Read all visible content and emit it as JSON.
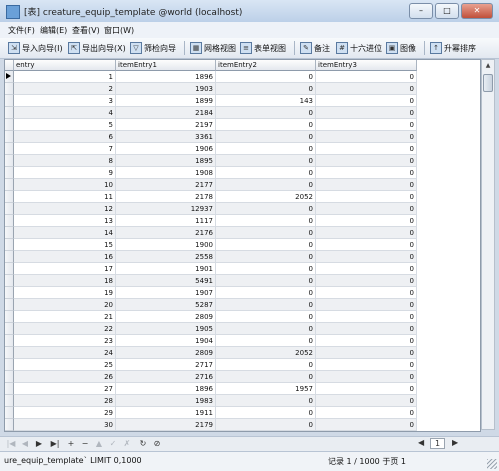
{
  "window": {
    "title": "[表] creature_equip_template @world (localhost)",
    "minimize_label": "–",
    "maximize_label": "□",
    "close_label": "✕"
  },
  "menu": [
    "文件(F)",
    "编辑(E)",
    "查看(V)",
    "窗口(W)"
  ],
  "toolbar": [
    {
      "label": "导入向导(I)",
      "icon": "import-icon"
    },
    {
      "label": "导出向导(X)",
      "icon": "export-icon"
    },
    {
      "label": "筛检向导",
      "icon": "filter-icon"
    },
    {
      "label": "网格视图",
      "icon": "grid-view-icon"
    },
    {
      "label": "表单视图",
      "icon": "form-view-icon"
    },
    {
      "label": "备注",
      "icon": "memo-icon"
    },
    {
      "label": "十六进位",
      "icon": "hex-icon"
    },
    {
      "label": "图像",
      "icon": "image-icon"
    },
    {
      "label": "升幂排序",
      "icon": "sort-asc-icon"
    }
  ],
  "table": {
    "columns": [
      "entry",
      "itemEntry1",
      "itemEntry2",
      "itemEntry3"
    ],
    "rows": [
      [
        1,
        1896,
        0,
        0
      ],
      [
        2,
        1903,
        0,
        0
      ],
      [
        3,
        1899,
        143,
        0
      ],
      [
        4,
        2184,
        0,
        0
      ],
      [
        5,
        2197,
        0,
        0
      ],
      [
        6,
        3361,
        0,
        0
      ],
      [
        7,
        1906,
        0,
        0
      ],
      [
        8,
        1895,
        0,
        0
      ],
      [
        9,
        1908,
        0,
        0
      ],
      [
        10,
        2177,
        0,
        0
      ],
      [
        11,
        2178,
        2052,
        0
      ],
      [
        12,
        12937,
        0,
        0
      ],
      [
        13,
        1117,
        0,
        0
      ],
      [
        14,
        2176,
        0,
        0
      ],
      [
        15,
        1900,
        0,
        0
      ],
      [
        16,
        2558,
        0,
        0
      ],
      [
        17,
        1901,
        0,
        0
      ],
      [
        18,
        5491,
        0,
        0
      ],
      [
        19,
        1907,
        0,
        0
      ],
      [
        20,
        5287,
        0,
        0
      ],
      [
        21,
        2809,
        0,
        0
      ],
      [
        22,
        1905,
        0,
        0
      ],
      [
        23,
        1904,
        0,
        0
      ],
      [
        24,
        2809,
        2052,
        0
      ],
      [
        25,
        2717,
        0,
        0
      ],
      [
        26,
        2716,
        0,
        0
      ],
      [
        27,
        1896,
        1957,
        0
      ],
      [
        28,
        1983,
        0,
        0
      ],
      [
        29,
        1911,
        0,
        0
      ],
      [
        30,
        2179,
        0,
        0
      ]
    ]
  },
  "navigator": {
    "buttons": [
      "|◀",
      "◀",
      "▶",
      "▶|",
      "+",
      "−",
      "▲",
      "✓",
      "✗",
      "↻",
      "⊘"
    ],
    "page_value": "1"
  },
  "status": {
    "query": "ure_equip_template` LIMIT 0,1000",
    "record": "记录 1 / 1000 于页 1"
  }
}
